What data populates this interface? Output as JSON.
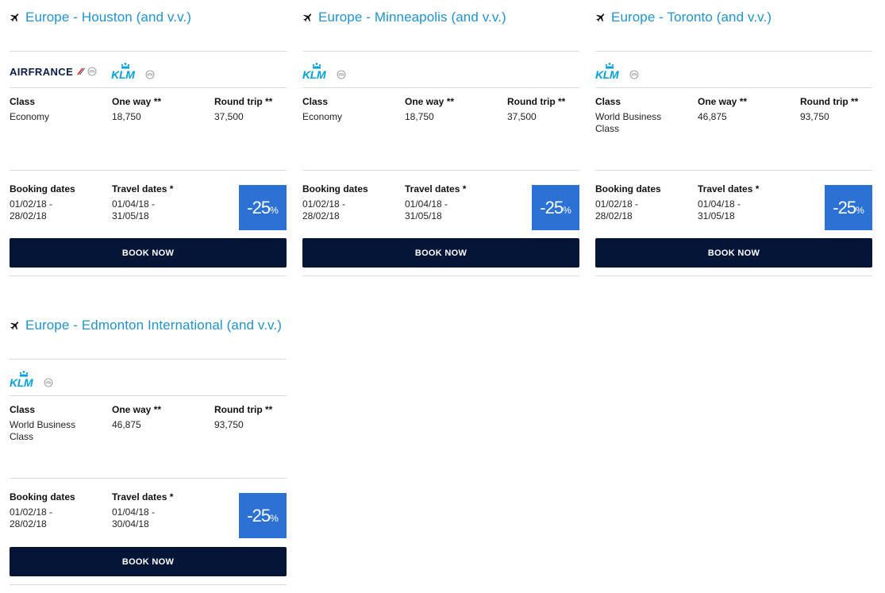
{
  "labels": {
    "class": "Class",
    "one_way": "One way **",
    "round_trip": "Round trip **",
    "booking_dates": "Booking dates",
    "travel_dates": "Travel dates *",
    "book_now": "BOOK NOW"
  },
  "logos": {
    "airfrance": "AIRFRANCE",
    "klm": "KLM"
  },
  "colors": {
    "title": "#1e93d0",
    "badge": "#2b72d4",
    "button": "#051538",
    "klm": "#00a1de"
  },
  "offers": [
    {
      "title": "Europe - Houston (and v.v.)",
      "class_line1": "Economy",
      "class_line2": "",
      "one_way": "18,750",
      "round_trip": "37,500",
      "booking_line1": "01/02/18 -",
      "booking_line2": "28/02/18",
      "travel_line1": "01/04/18 -",
      "travel_line2": "31/05/18",
      "discount": "-25",
      "discount_unit": "%"
    },
    {
      "title": "Europe - Minneapolis (and v.v.)",
      "class_line1": "Economy",
      "class_line2": "",
      "one_way": "18,750",
      "round_trip": "37,500",
      "booking_line1": "01/02/18 -",
      "booking_line2": "28/02/18",
      "travel_line1": "01/04/18 -",
      "travel_line2": "31/05/18",
      "discount": "-25",
      "discount_unit": "%"
    },
    {
      "title": "Europe - Toronto (and v.v.)",
      "class_line1": "World Business",
      "class_line2": "Class",
      "one_way": "46,875",
      "round_trip": "93,750",
      "booking_line1": "01/02/18 -",
      "booking_line2": "28/02/18",
      "travel_line1": "01/04/18 -",
      "travel_line2": "31/05/18",
      "discount": "-25",
      "discount_unit": "%"
    },
    {
      "title": "Europe - Edmonton International (and v.v.)",
      "class_line1": "World Business",
      "class_line2": "Class",
      "one_way": "46,875",
      "round_trip": "93,750",
      "booking_line1": "01/02/18 -",
      "booking_line2": "28/02/18",
      "travel_line1": "01/04/18 -",
      "travel_line2": "30/04/18",
      "discount": "-25",
      "discount_unit": "%"
    }
  ]
}
